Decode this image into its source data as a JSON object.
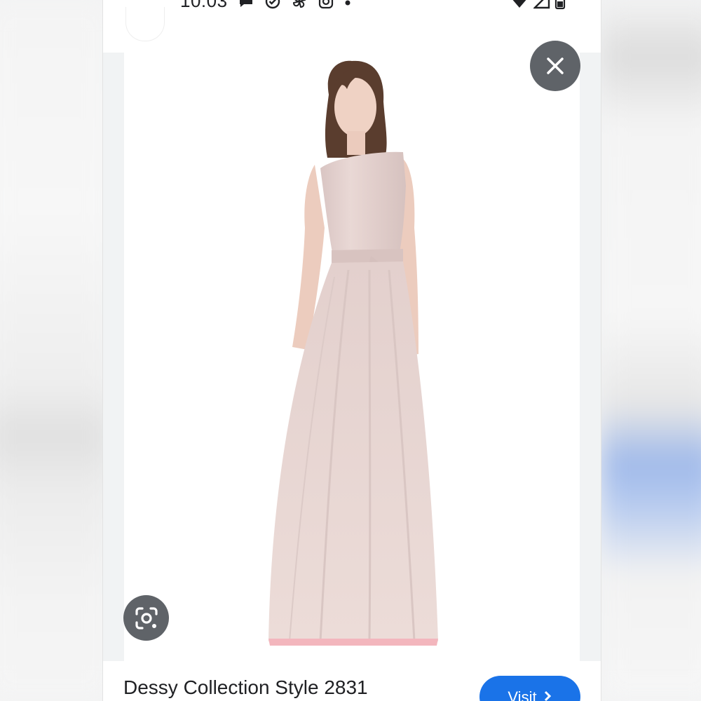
{
  "status_bar": {
    "time": "10:03",
    "left_icons": [
      "chat-bubble-icon",
      "check-circle-icon",
      "pinwheel-icon",
      "instagram-icon",
      "dot-icon"
    ],
    "right_icons": [
      "wifi-icon",
      "signal-icon",
      "battery-icon"
    ]
  },
  "viewer": {
    "close_icon": "close-icon",
    "lens_icon": "lens-icon"
  },
  "result": {
    "title": "Dessy Collection Style 2831",
    "visit_label": "Visit",
    "visit_icon": "chevron-right-icon"
  },
  "colors": {
    "accent": "#1a73e8",
    "overlay_button": "#5f6368",
    "dress": "#e6d3d0",
    "text_primary": "#202124"
  }
}
